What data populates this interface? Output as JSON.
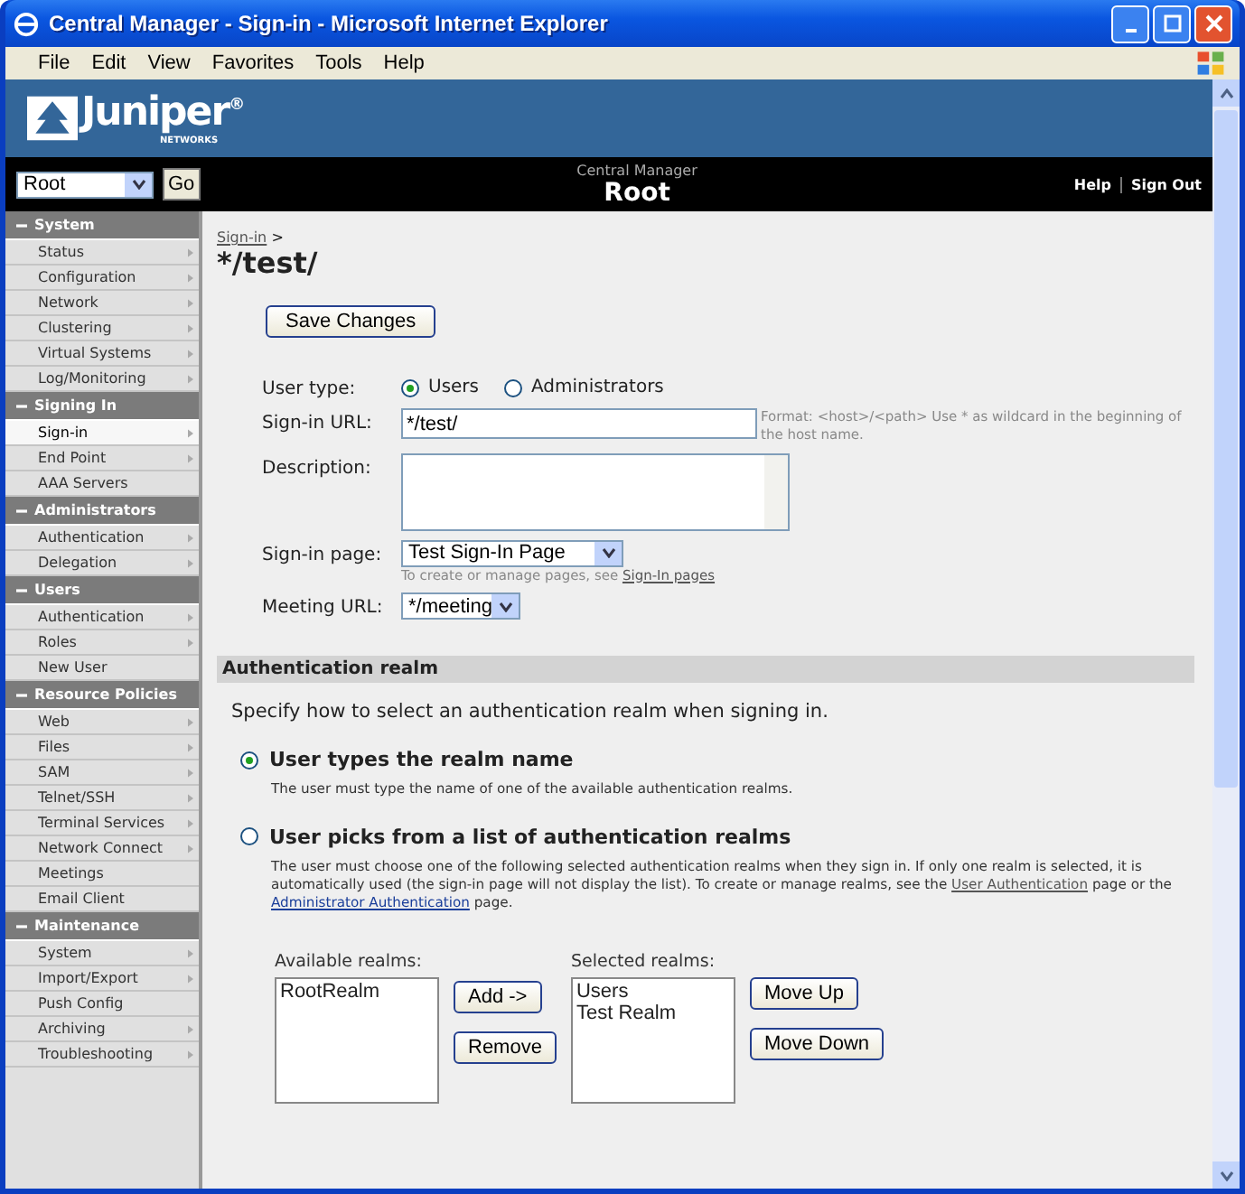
{
  "window": {
    "title": "Central Manager - Sign-in - Microsoft Internet Explorer"
  },
  "menu": [
    "File",
    "Edit",
    "View",
    "Favorites",
    "Tools",
    "Help"
  ],
  "logo": {
    "name": "Juniper",
    "mark": "®",
    "tagline": "NETWORKS"
  },
  "top_bar": {
    "select_value": "Root",
    "go_button": "Go",
    "subtitle": "Central Manager",
    "title": "Root",
    "links": [
      "Help",
      "Sign Out"
    ]
  },
  "sidebar": {
    "sections": [
      {
        "title": "System",
        "expanded": true,
        "items": [
          {
            "label": "Status",
            "selected": false,
            "submenu": true
          },
          {
            "label": "Configuration",
            "selected": false,
            "submenu": true
          },
          {
            "label": "Network",
            "selected": false,
            "submenu": true
          },
          {
            "label": "Clustering",
            "selected": false,
            "submenu": true
          },
          {
            "label": "Virtual Systems",
            "selected": false,
            "submenu": true
          },
          {
            "label": "Log/Monitoring",
            "selected": false,
            "submenu": true
          }
        ]
      },
      {
        "title": "Signing In",
        "expanded": true,
        "items": [
          {
            "label": "Sign-in",
            "selected": true,
            "submenu": true
          },
          {
            "label": "End Point",
            "selected": false,
            "submenu": true
          },
          {
            "label": "AAA Servers",
            "selected": false,
            "submenu": false
          }
        ]
      },
      {
        "title": "Administrators",
        "expanded": true,
        "items": [
          {
            "label": "Authentication",
            "selected": false,
            "submenu": true
          },
          {
            "label": "Delegation",
            "selected": false,
            "submenu": true
          }
        ]
      },
      {
        "title": "Users",
        "expanded": true,
        "items": [
          {
            "label": "Authentication",
            "selected": false,
            "submenu": true
          },
          {
            "label": "Roles",
            "selected": false,
            "submenu": true
          },
          {
            "label": "New User",
            "selected": false,
            "submenu": false
          }
        ]
      },
      {
        "title": "Resource Policies",
        "expanded": true,
        "items": [
          {
            "label": "Web",
            "selected": false,
            "submenu": true
          },
          {
            "label": "Files",
            "selected": false,
            "submenu": true
          },
          {
            "label": "SAM",
            "selected": false,
            "submenu": true
          },
          {
            "label": "Telnet/SSH",
            "selected": false,
            "submenu": true
          },
          {
            "label": "Terminal Services",
            "selected": false,
            "submenu": true
          },
          {
            "label": "Network Connect",
            "selected": false,
            "submenu": true
          },
          {
            "label": "Meetings",
            "selected": false,
            "submenu": false
          },
          {
            "label": "Email Client",
            "selected": false,
            "submenu": false
          }
        ]
      },
      {
        "title": "Maintenance",
        "expanded": true,
        "items": [
          {
            "label": "System",
            "selected": false,
            "submenu": true
          },
          {
            "label": "Import/Export",
            "selected": false,
            "submenu": true
          },
          {
            "label": "Push Config",
            "selected": false,
            "submenu": false
          },
          {
            "label": "Archiving",
            "selected": false,
            "submenu": true
          },
          {
            "label": "Troubleshooting",
            "selected": false,
            "submenu": true
          }
        ]
      }
    ]
  },
  "breadcrumb": {
    "link": "Sign-in",
    "separator": ">"
  },
  "heading": "*/test/",
  "save_button": "Save Changes",
  "user_type": {
    "label": "User type:",
    "options": [
      {
        "label": "Users",
        "selected": true
      },
      {
        "label": "Administrators",
        "selected": false
      }
    ]
  },
  "sign_in_url": {
    "label": "Sign-in URL:",
    "value": "*/test/",
    "hint": "Format: <host>/<path>    Use * as wildcard in the beginning of the host name."
  },
  "description": {
    "label": "Description:"
  },
  "sign_in_page": {
    "label": "Sign-in page:",
    "value": "Test Sign-In Page",
    "hint": "To create or manage pages, see",
    "hint_link": "Sign-In pages"
  },
  "meeting_url": {
    "label": "Meeting URL:",
    "value": "*/meeting"
  },
  "realm_section": {
    "title": "Authentication realm",
    "intro": "Specify how to select an authentication realm when signing in.",
    "options": [
      {
        "title": "User types the realm name",
        "selected": true,
        "parts": [
          {
            "kind": "text",
            "text": "The user must type the name of one of the available authentication realms."
          }
        ]
      },
      {
        "title": "User picks from a list of authentication realms",
        "selected": false,
        "parts": [
          {
            "kind": "text",
            "text": "The user must choose one of the following selected authentication realms when they sign in. If only one realm is selected, it is automatically used (the sign-in page will not display the list). To create or manage realms, see the"
          },
          {
            "kind": "link",
            "text": "User Authentication",
            "visited": true
          },
          {
            "kind": "text",
            "text": "page or the"
          },
          {
            "kind": "link",
            "text": "Administrator Authentication",
            "visited": false
          },
          {
            "kind": "text",
            "text": "page."
          }
        ]
      }
    ]
  },
  "available_realms": {
    "label": "Available realms:",
    "items": [
      "RootRealm"
    ]
  },
  "transfer_buttons": [
    "Add ->",
    "Remove"
  ],
  "selected_realms": {
    "label": "Selected realms:",
    "items": [
      "Users",
      "Test Realm"
    ]
  },
  "order_buttons": [
    "Move Up",
    "Move Down"
  ]
}
